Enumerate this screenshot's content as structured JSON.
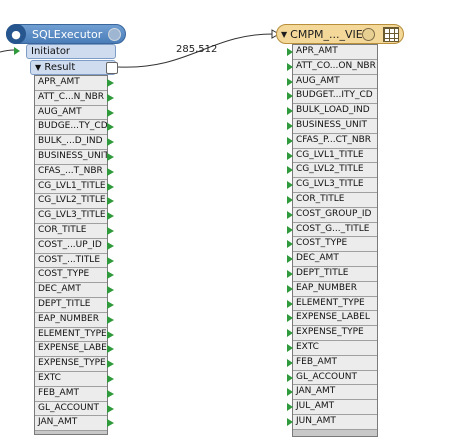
{
  "executor": {
    "title": "SQLExecutor",
    "initiator_label": "Initiator",
    "result_label": "Result",
    "attributes": [
      "APR_AMT",
      "ATT_C...N_NBR",
      "AUG_AMT",
      "BUDGE...TY_CD",
      "BULK_...D_IND",
      "BUSINESS_UNIT",
      "CFAS_...T_NBR",
      "CG_LVL1_TITLE",
      "CG_LVL2_TITLE",
      "CG_LVL3_TITLE",
      "COR_TITLE",
      "COST_...UP_ID",
      "COST_...TITLE",
      "COST_TYPE",
      "DEC_AMT",
      "DEPT_TITLE",
      "EAP_NUMBER",
      "ELEMENT_TYPE",
      "EXPENSE_LABEL",
      "EXPENSE_TYPE",
      "EXTC",
      "FEB_AMT",
      "GL_ACCOUNT",
      "JAN_AMT"
    ]
  },
  "connection": {
    "feature_count": "285,512"
  },
  "writer": {
    "title": "CMPM_..._VIEW",
    "attributes": [
      "APR_AMT",
      "ATT_CO...ON_NBR",
      "AUG_AMT",
      "BUDGET...ITY_CD",
      "BULK_LOAD_IND",
      "BUSINESS_UNIT",
      "CFAS_P...CT_NBR",
      "CG_LVL1_TITLE",
      "CG_LVL2_TITLE",
      "CG_LVL3_TITLE",
      "COR_TITLE",
      "COST_GROUP_ID",
      "COST_G..._TITLE",
      "COST_TYPE",
      "DEC_AMT",
      "DEPT_TITLE",
      "EAP_NUMBER",
      "ELEMENT_TYPE",
      "EXPENSE_LABEL",
      "EXPENSE_TYPE",
      "EXTC",
      "FEB_AMT",
      "GL_ACCOUNT",
      "JAN_AMT",
      "JUL_AMT",
      "JUN_AMT"
    ]
  },
  "colors": {
    "port_arrow": "#2f9a3b",
    "executor_header": "#4a7cb8",
    "writer_header": "#f3d89a"
  }
}
